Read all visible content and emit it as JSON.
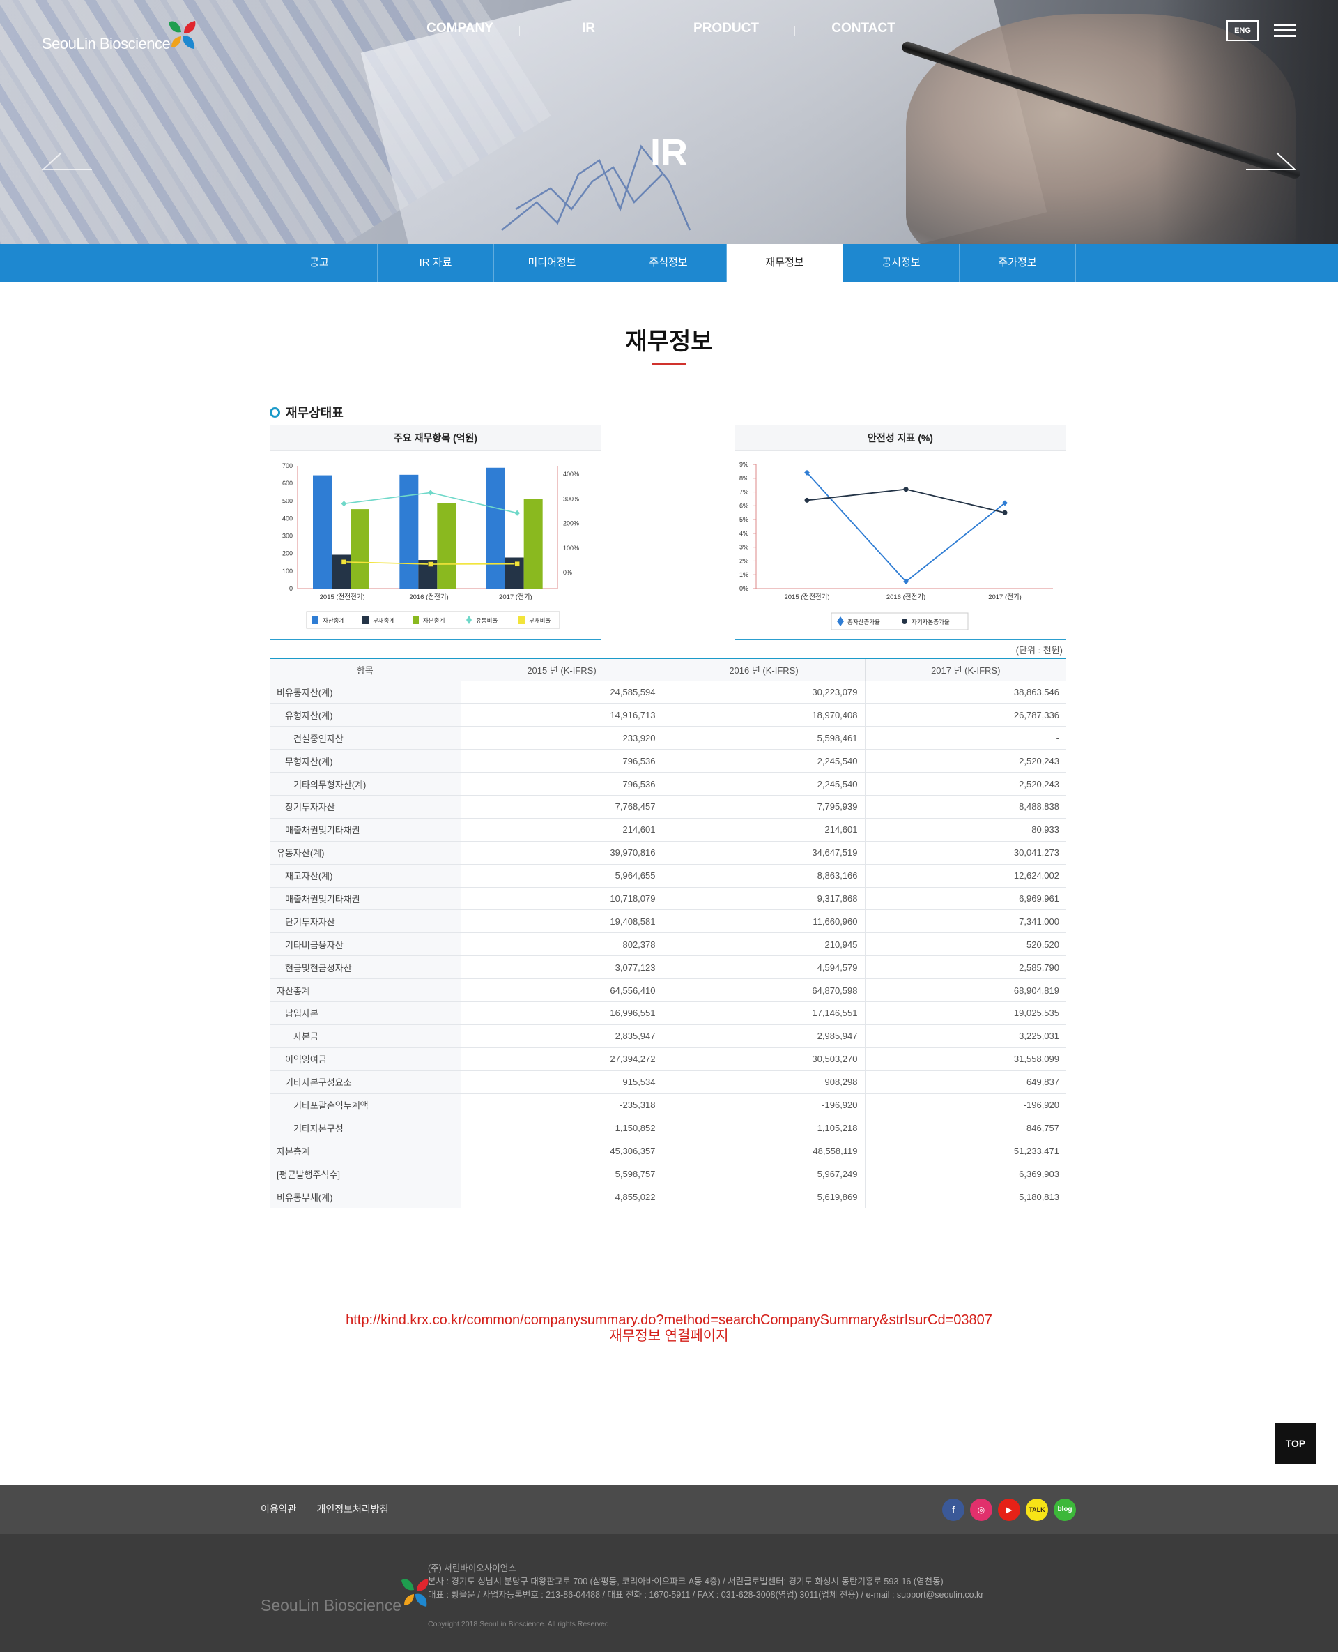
{
  "header": {
    "logo_text": "SeouLin Bioscience",
    "nav": [
      "COMPANY",
      "IR",
      "PRODUCT",
      "CONTACT"
    ],
    "lang_button": "ENG",
    "hero_title": "IR"
  },
  "subnav": {
    "items": [
      "공고",
      "IR 자료",
      "미디어정보",
      "주식정보",
      "재무정보",
      "공시정보",
      "주가정보"
    ],
    "active_index": 4
  },
  "page": {
    "title": "재무정보",
    "section_title": "재무상태표",
    "unit_note": "(단위 : 천원)",
    "link_url": "http://kind.krx.co.kr/common/companysummary.do?method=searchCompanySummary&strIsurCd=03807",
    "link_caption": "재무정보 연결페이지",
    "top_button": "TOP"
  },
  "chart_data": [
    {
      "type": "bar",
      "title": "주요 재무항목 (억원)",
      "categories": [
        "2015 (전전전기)",
        "2016 (전전기)",
        "2017 (전기)"
      ],
      "y_ticks": [
        "700",
        "600",
        "500",
        "400",
        "300",
        "200",
        "100",
        "0"
      ],
      "y2_ticks": [
        "400%",
        "300%",
        "200%",
        "100%",
        "0%"
      ],
      "ylim": [
        0,
        700
      ],
      "y2lim": [
        -100,
        400
      ],
      "series": [
        {
          "name": "자산총계",
          "kind": "bar",
          "color": "#2f7dd4",
          "values": [
            646,
            649,
            689
          ]
        },
        {
          "name": "부채총계",
          "kind": "bar",
          "color": "#243447",
          "values": [
            193,
            163,
            177
          ]
        },
        {
          "name": "자본총계",
          "kind": "bar",
          "color": "#8ab91f",
          "values": [
            453,
            486,
            512
          ]
        },
        {
          "name": "유동비율",
          "kind": "line",
          "axis": "right",
          "color": "#6fd8c9",
          "values": [
            280,
            325,
            242
          ]
        },
        {
          "name": "부채비율",
          "kind": "line",
          "axis": "right",
          "color": "#f2e43a",
          "values": [
            43,
            34,
            35
          ]
        }
      ]
    },
    {
      "type": "line",
      "title": "안전성 지표 (%)",
      "categories": [
        "2015 (전전전기)",
        "2016 (전전기)",
        "2017 (전기)"
      ],
      "y_ticks": [
        "9%",
        "8%",
        "7%",
        "6%",
        "5%",
        "4%",
        "3%",
        "2%",
        "1%",
        "0%"
      ],
      "ylim": [
        0,
        9
      ],
      "series": [
        {
          "name": "총자산증가율",
          "color": "#2f7dd4",
          "marker": "diamond",
          "values": [
            8.4,
            0.5,
            6.2
          ]
        },
        {
          "name": "자기자본증가율",
          "color": "#243447",
          "marker": "circle",
          "values": [
            6.4,
            7.2,
            5.5
          ]
        }
      ]
    }
  ],
  "table": {
    "headers": [
      "항목",
      "2015 년 (K-IFRS)",
      "2016 년 (K-IFRS)",
      "2017 년 (K-IFRS)"
    ],
    "rows": [
      {
        "label": "비유동자산(계)",
        "level": 0,
        "values": [
          "24,585,594",
          "30,223,079",
          "38,863,546"
        ]
      },
      {
        "label": "유형자산(계)",
        "level": 1,
        "values": [
          "14,916,713",
          "18,970,408",
          "26,787,336"
        ]
      },
      {
        "label": "건설중인자산",
        "level": 2,
        "values": [
          "233,920",
          "5,598,461",
          "-"
        ]
      },
      {
        "label": "무형자산(계)",
        "level": 1,
        "values": [
          "796,536",
          "2,245,540",
          "2,520,243"
        ]
      },
      {
        "label": "기타의무형자산(계)",
        "level": 2,
        "values": [
          "796,536",
          "2,245,540",
          "2,520,243"
        ]
      },
      {
        "label": "장기투자자산",
        "level": 1,
        "values": [
          "7,768,457",
          "7,795,939",
          "8,488,838"
        ]
      },
      {
        "label": "매출채권및기타채권",
        "level": 1,
        "values": [
          "214,601",
          "214,601",
          "80,933"
        ]
      },
      {
        "label": "유동자산(계)",
        "level": 0,
        "values": [
          "39,970,816",
          "34,647,519",
          "30,041,273"
        ]
      },
      {
        "label": "재고자산(계)",
        "level": 1,
        "values": [
          "5,964,655",
          "8,863,166",
          "12,624,002"
        ]
      },
      {
        "label": "매출채권및기타채권",
        "level": 1,
        "values": [
          "10,718,079",
          "9,317,868",
          "6,969,961"
        ]
      },
      {
        "label": "단기투자자산",
        "level": 1,
        "values": [
          "19,408,581",
          "11,660,960",
          "7,341,000"
        ]
      },
      {
        "label": "기타비금융자산",
        "level": 1,
        "values": [
          "802,378",
          "210,945",
          "520,520"
        ]
      },
      {
        "label": "현금및현금성자산",
        "level": 1,
        "values": [
          "3,077,123",
          "4,594,579",
          "2,585,790"
        ]
      },
      {
        "label": "자산총계",
        "level": 0,
        "values": [
          "64,556,410",
          "64,870,598",
          "68,904,819"
        ]
      },
      {
        "label": "납입자본",
        "level": 1,
        "values": [
          "16,996,551",
          "17,146,551",
          "19,025,535"
        ]
      },
      {
        "label": "자본금",
        "level": 2,
        "values": [
          "2,835,947",
          "2,985,947",
          "3,225,031"
        ]
      },
      {
        "label": "이익잉여금",
        "level": 1,
        "values": [
          "27,394,272",
          "30,503,270",
          "31,558,099"
        ]
      },
      {
        "label": "기타자본구성요소",
        "level": 1,
        "values": [
          "915,534",
          "908,298",
          "649,837"
        ]
      },
      {
        "label": "기타포괄손익누계액",
        "level": 2,
        "values": [
          "-235,318",
          "-196,920",
          "-196,920"
        ]
      },
      {
        "label": "기타자본구성",
        "level": 2,
        "values": [
          "1,150,852",
          "1,105,218",
          "846,757"
        ]
      },
      {
        "label": "자본총계",
        "level": 0,
        "values": [
          "45,306,357",
          "48,558,119",
          "51,233,471"
        ]
      },
      {
        "label": "[평균발행주식수]",
        "level": 0,
        "values": [
          "5,598,757",
          "5,967,249",
          "6,369,903"
        ]
      },
      {
        "label": "비유동부채(계)",
        "level": 0,
        "values": [
          "4,855,022",
          "5,619,869",
          "5,180,813"
        ]
      }
    ]
  },
  "footer": {
    "links": [
      "이용약관",
      "개인정보처리방침"
    ],
    "sns": [
      {
        "name": "facebook-icon",
        "label": "f",
        "color": "#3b5998"
      },
      {
        "name": "instagram-icon",
        "label": "◎",
        "color": "#e1306c"
      },
      {
        "name": "youtube-icon",
        "label": "▶",
        "color": "#e62117"
      },
      {
        "name": "kakaotalk-icon",
        "label": "TALK",
        "color": "#f7e317"
      },
      {
        "name": "blog-icon",
        "label": "blog",
        "color": "#3db83a"
      }
    ],
    "logo_text": "SeouLin Bioscience",
    "company": "(주) 서린바이오사이언스",
    "address": "본사 : 경기도 성남시 분당구 대왕판교로 700 (삼평동, 코리아바이오파크 A동 4층) / 서린글로벌센터: 경기도 화성시 동탄기흥로 593-16 (영천동)",
    "contact": "대표 : 황을문 / 사업자등록번호 : 213-86-04488 / 대표 전화 : 1670-5911 / FAX : 031-628-3008(영업) 3011(업체 전용) / e-mail : support@seoulin.co.kr",
    "copyright": "Copyright 2018 SeouLin Bioscience. All rights Reserved"
  }
}
